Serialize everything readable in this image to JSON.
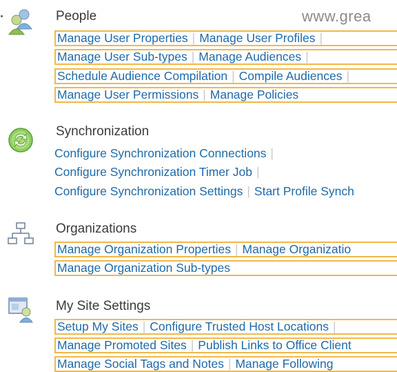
{
  "watermark": "www.grea",
  "sections": {
    "people": {
      "title": "People",
      "icon": "people-icon",
      "rows": [
        [
          "Manage User Properties",
          "Manage User Profiles"
        ],
        [
          "Manage User Sub-types",
          "Manage Audiences"
        ],
        [
          "Schedule Audience Compilation",
          "Compile Audiences"
        ],
        [
          "Manage User Permissions",
          "Manage Policies"
        ]
      ]
    },
    "sync": {
      "title": "Synchronization",
      "icon": "sync-icon",
      "rows": [
        [
          "Configure Synchronization Connections"
        ],
        [
          "Configure Synchronization Timer Job"
        ],
        [
          "Configure Synchronization Settings",
          "Start Profile Synch"
        ]
      ]
    },
    "orgs": {
      "title": "Organizations",
      "icon": "org-chart-icon",
      "rows": [
        [
          "Manage Organization Properties",
          "Manage Organizatio"
        ],
        [
          "Manage Organization Sub-types"
        ]
      ]
    },
    "mysite": {
      "title": "My Site Settings",
      "icon": "my-site-icon",
      "rows": [
        [
          "Setup My Sites",
          "Configure Trusted Host Locations"
        ],
        [
          "Manage Promoted Sites",
          "Publish Links to Office Client"
        ],
        [
          "Manage Social Tags and Notes",
          "Manage Following"
        ]
      ]
    }
  },
  "colors": {
    "link": "#1f6aa8",
    "highlight_box": "#f0b84a",
    "title": "#3b3b3b",
    "separator": "#c9c9c9"
  }
}
